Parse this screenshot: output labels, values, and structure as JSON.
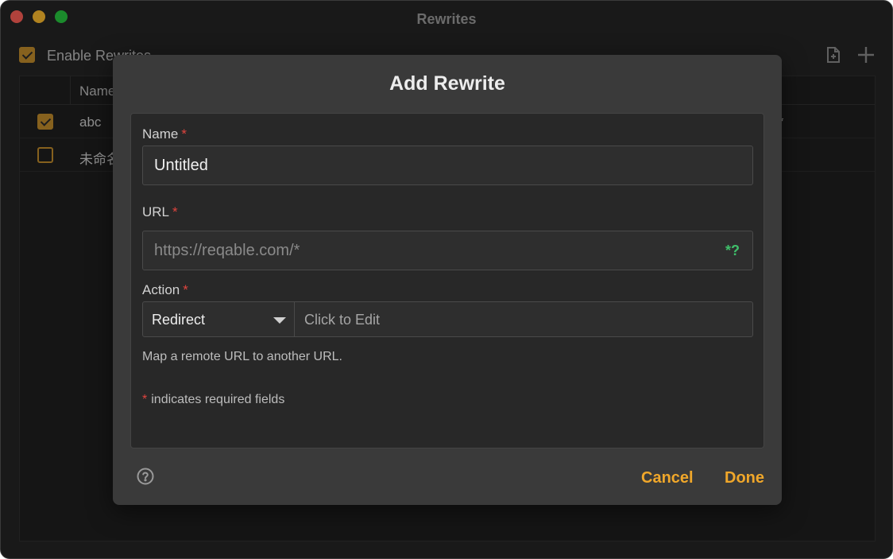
{
  "window": {
    "title": "Rewrites"
  },
  "toolbar": {
    "enable_label": "Enable Rewrites",
    "enable_checked": true
  },
  "table": {
    "header_name": "Name",
    "rows": [
      {
        "checked": true,
        "name": "abc",
        "url": "/*"
      },
      {
        "checked": false,
        "name": "未命名"
      }
    ]
  },
  "dialog": {
    "title": "Add Rewrite",
    "name_label": "Name",
    "name_value": "Untitled",
    "url_label": "URL",
    "url_placeholder": "https://reqable.com/*",
    "url_value": "",
    "regex_toggle": "*?",
    "action_label": "Action",
    "action_value": "Redirect",
    "action_edit": "Click to Edit",
    "hint": "Map a remote URL to another URL.",
    "required_star": "*",
    "required_note": "indicates required fields",
    "cancel_label": "Cancel",
    "done_label": "Done"
  },
  "colors": {
    "accent": "#f0a72a",
    "checkbox": "#c18b2c",
    "required": "#e0443e",
    "regex": "#3fbf6a"
  },
  "icons": {
    "import": "file-import-icon",
    "add": "plus-icon",
    "help": "question-circle-icon"
  }
}
